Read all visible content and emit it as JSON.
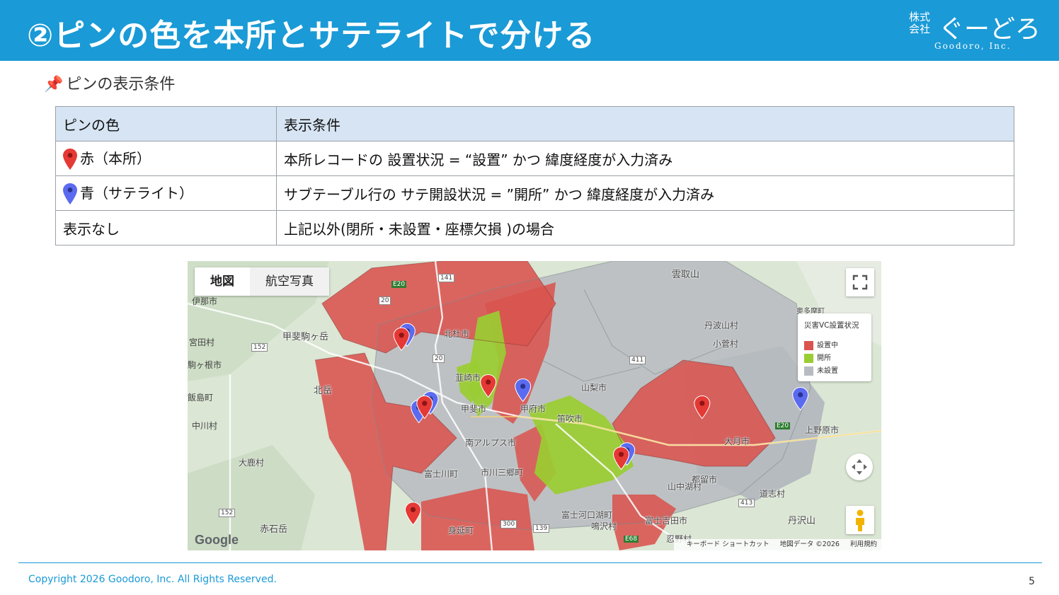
{
  "slide": {
    "title": "②ピンの色を本所とサテライトで分ける",
    "logo": {
      "kabushiki": "株式\n会社",
      "name": "ぐーどろ",
      "english": "Goodoro, Inc."
    },
    "subtitle_icon": "pushpin-icon",
    "subtitle": "ピンの表示条件",
    "copyright": "Copyright 2026 Goodoro, Inc. All Rights Reserved.",
    "page_number": "5"
  },
  "table": {
    "headers": [
      "ピンの色",
      "表示条件"
    ],
    "rows": [
      {
        "icon": "red-pin-icon",
        "color": "#e53935",
        "label": "赤（本所）",
        "condition": "本所レコードの 設置状況 = “設置” かつ 緯度経度が入力済み"
      },
      {
        "icon": "blue-pin-icon",
        "color": "#5b6bf0",
        "label": "青（サテライト）",
        "condition": "サブテーブル行の サテ開設状況 = ”開所” かつ 緯度経度が入力済み"
      },
      {
        "icon": "",
        "color": "",
        "label": "表示なし",
        "condition": "上記以外(閉所・未設置・座標欠損 )の場合"
      }
    ]
  },
  "map": {
    "tabs": [
      {
        "label": "地図",
        "active": true
      },
      {
        "label": "航空写真",
        "active": false
      }
    ],
    "legend": {
      "title": "災害VC設置状況",
      "items": [
        {
          "label": "設置中",
          "color": "#d9534f"
        },
        {
          "label": "開所",
          "color": "#9acd32"
        },
        {
          "label": "未設置",
          "color": "#b8bcc2"
        }
      ]
    },
    "place_labels": {
      "hokuto": "北杜市",
      "kai_koma": "甲斐駒ヶ岳",
      "nirasaki": "韮崎市",
      "kai": "甲斐市",
      "kofu": "甲府市",
      "yamanashi": "山梨市",
      "fuefuki": "笛吹市",
      "minami_alps": "南アルプス市",
      "fujikawaguchiko": "富士河口湖町",
      "fujiyoshida": "富士吉田市",
      "otsuki": "大月市",
      "uenohara": "上野原市",
      "tsuru": "都留市",
      "kumotori": "雲取山",
      "tanzawa": "丹沢山",
      "kita_dake": "北岳",
      "ina": "伊那市",
      "miyada": "宮田村",
      "komagane": "駒ヶ根市",
      "iijima": "飯島町",
      "nakagawa": "中川村",
      "oshika": "大鹿村",
      "akaishi": "赤石岳",
      "tabayama": "丹波山村",
      "kosuge": "小菅村",
      "narusawa": "鳴沢村",
      "fujikawa": "富士川町",
      "ichikawamisato": "市川三郷町",
      "doshi": "道志村",
      "oshino": "忍野村",
      "minobu": "身延町",
      "okutama": "奥多摩町",
      "yamanakako": "山中湖村"
    },
    "route_labels": [
      "141",
      "20",
      "152",
      "20",
      "411",
      "E20",
      "E20",
      "413",
      "139",
      "300",
      "152",
      "E68"
    ],
    "attribution": {
      "keyboard": "キーボード ショートカット",
      "data": "地図データ ©2026",
      "terms": "利用規約"
    },
    "google": "Google",
    "icons": {
      "fullscreen": "fullscreen-icon",
      "camera": "camera-control-icon",
      "pegman": "pegman-icon"
    }
  },
  "pins": {
    "red": [
      {
        "name": "hokuto",
        "lon": 138.42,
        "lat": 35.77
      },
      {
        "name": "kofu",
        "lon": 138.57,
        "lat": 35.66
      },
      {
        "name": "otsuki",
        "lon": 138.94,
        "lat": 35.61
      },
      {
        "name": "fujiyoshida",
        "lon": 138.8,
        "lat": 35.49
      },
      {
        "name": "minobu",
        "lon": 138.44,
        "lat": 35.36
      },
      {
        "name": "minami_alps",
        "lon": 138.46,
        "lat": 35.61
      }
    ],
    "blue": [
      {
        "name": "hokuto",
        "lon": 138.43,
        "lat": 35.78
      },
      {
        "name": "fuefuki",
        "lon": 138.63,
        "lat": 35.65
      },
      {
        "name": "uenohara",
        "lon": 139.11,
        "lat": 35.63
      },
      {
        "name": "minami_alps",
        "lon": 138.47,
        "lat": 35.62
      },
      {
        "name": "minami_alps_2",
        "lon": 138.45,
        "lat": 35.6
      },
      {
        "name": "fujiyoshida",
        "lon": 138.81,
        "lat": 35.5
      }
    ]
  }
}
